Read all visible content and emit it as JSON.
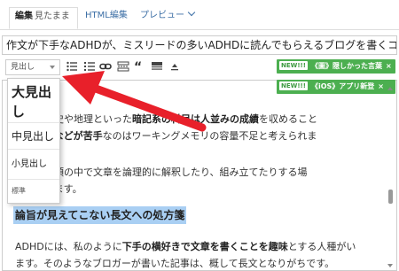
{
  "tabs": {
    "edit_label": "編集",
    "edit_sub": "見たまま",
    "html_label": "HTML編集",
    "preview_label": "プレビュー"
  },
  "title_value": "作文が下手なADHDが、ミスリードの多いADHDに読んでもらえるブログを書くコツ",
  "toolbar": {
    "heading_select": "見出し",
    "icons": [
      "bullet-list-icon",
      "numbered-list-icon",
      "link-icon",
      "more-separator-icon",
      "quote-icon",
      "table-icon",
      "clear-format-icon"
    ]
  },
  "banners": [
    {
      "badge": "NEW!!!",
      "text": "《圖》隠しかった言葉",
      "close": "×"
    },
    {
      "badge": "NEW!!!",
      "text": "《iOS》アプリ新登",
      "close": "×"
    }
  ],
  "dropdown": {
    "items": [
      "大見出し",
      "中見出し",
      "小見出し",
      "標準"
    ]
  },
  "editor": {
    "p1_prefix": "子供が歴史や地理といった",
    "p1_bold": "暗記系の科目は人並みの成績",
    "p1_suffix": "を収めること",
    "p2_prefix": "も、",
    "p2_bold": "暗算などが苦手",
    "p2_suffix": "なのはワーキングメモリの容量不足と考えられま",
    "p3": "、自分の頭の中で文章を論理的に解釈したり、組み立てたりする場",
    "p4": "なります。",
    "p4_mid": "害と",
    "heading": "論旨が見えてこない長文への処方箋",
    "p5_prefix": "ADHDには、私のように",
    "p5_bold": "下手の横好きで文章を書くことを趣味",
    "p5_suffix": "とする人種がい",
    "p6": "ます。そのようなブロガーが書いた記事は、概して長文となりがちです。"
  },
  "colors": {
    "accent_blue": "#3b6ea5",
    "banner_green": "#4caf50",
    "highlight": "#a9cff3",
    "arrow_red": "#e8202a"
  }
}
